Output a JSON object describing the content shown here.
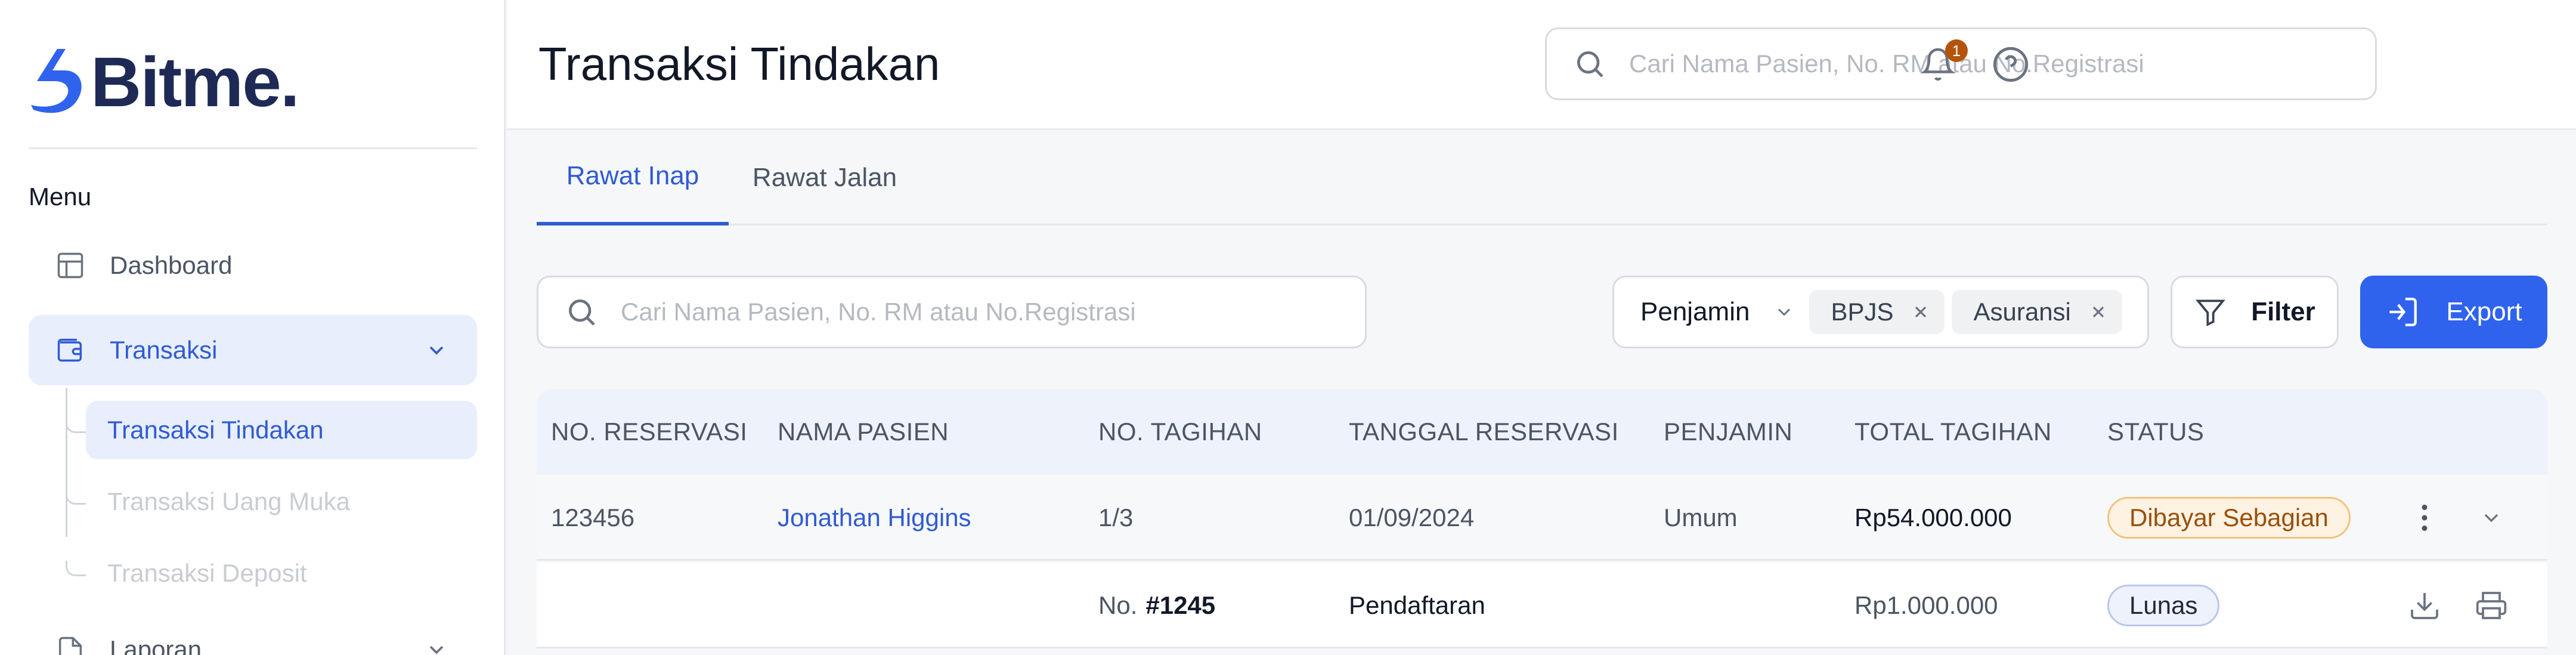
{
  "app": {
    "logo_text": "Bitme",
    "logo_dot": "."
  },
  "sidebar": {
    "menu_label": "Menu",
    "items": [
      {
        "label": "Dashboard",
        "icon": "layout-icon"
      },
      {
        "label": "Transaksi",
        "icon": "wallet-icon",
        "active": true
      },
      {
        "label": "Laporan",
        "icon": "report-icon"
      }
    ],
    "sub_items": [
      {
        "label": "Transaksi Tindakan",
        "active": true
      },
      {
        "label": "Transaksi Uang Muka"
      },
      {
        "label": "Transaksi Deposit"
      }
    ]
  },
  "header": {
    "title": "Transaksi Tindakan",
    "search_placeholder": "Cari Nama Pasien, No. RM atau No.Registrasi",
    "notification_count": "1"
  },
  "tabs": [
    {
      "label": "Rawat Inap",
      "active": true
    },
    {
      "label": "Rawat Jalan"
    }
  ],
  "filters": {
    "search_placeholder": "Cari Nama Pasien, No. RM atau No.Registrasi",
    "penjamin_label": "Penjamin",
    "chips": [
      "BPJS",
      "Asuransi"
    ],
    "filter_label": "Filter",
    "export_label": "Export"
  },
  "table": {
    "columns": [
      "NO. RESERVASI",
      "NAMA PASIEN",
      "NO. TAGIHAN",
      "TANGGAL RESERVASI",
      "PENJAMIN",
      "TOTAL TAGIHAN",
      "STATUS"
    ],
    "rows": [
      {
        "reservasi": "123456",
        "nama": "Jonathan Higgins",
        "tagihan": "1/3",
        "tanggal": "01/09/2024",
        "penjamin": "Umum",
        "total": "Rp54.000.000",
        "status": "Dibayar Sebagian"
      }
    ],
    "sub_rows": [
      {
        "no_prefix": "No.",
        "no_value": "#1245",
        "item": "Pendaftaran",
        "total": "Rp1.000.000",
        "status": "Lunas"
      }
    ]
  },
  "colors": {
    "accent": "#2f63ee",
    "brand": "#1e2a55",
    "status_partial": "#9a4f0a",
    "badge_notification": "#b45309"
  }
}
